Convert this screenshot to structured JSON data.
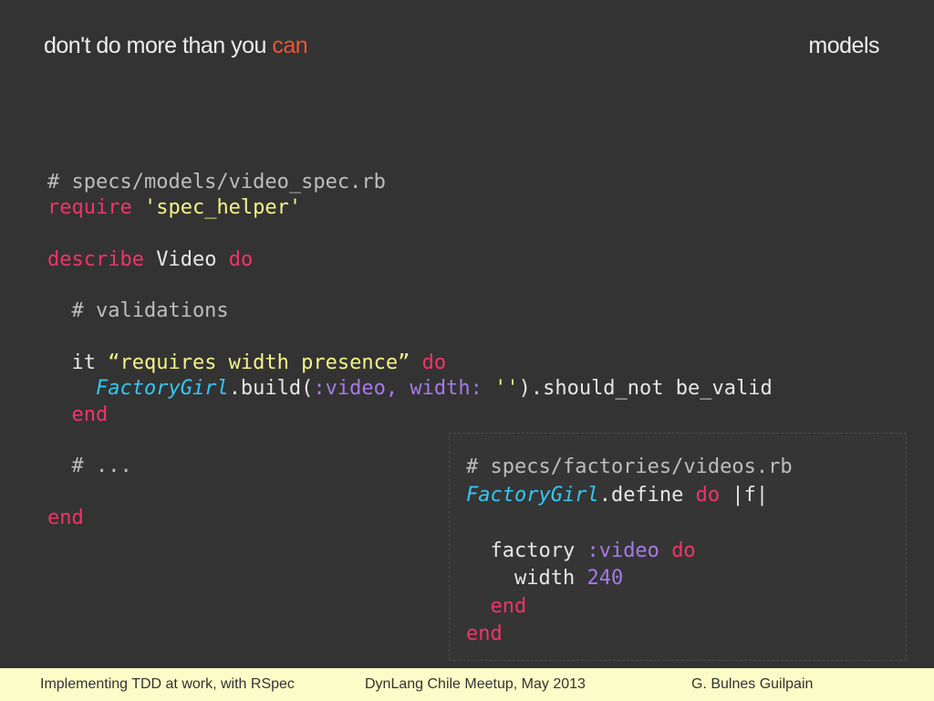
{
  "slide": {
    "title_prefix": "don't do more than you ",
    "title_accent": "can",
    "section": "models"
  },
  "main_code": {
    "line1": "# specs/models/video_spec.rb",
    "line2_kw": "require",
    "line2_str": "'spec_helper'",
    "line4_kw": "describe",
    "line4_class": "Video",
    "line4_do": "do",
    "line6": "  # validations",
    "line8_it": "  it",
    "line8_str": "“requires width presence”",
    "line8_do": "do",
    "line9_const": "FactoryGirl",
    "line9_a": ".build(",
    "line9_sym": ":video, width:",
    "line9_str": "''",
    "line9_b": ").should_not be_valid",
    "line10_end": "end",
    "line12": "  # ...",
    "line14_end": "end"
  },
  "factory_code": {
    "line1": "# specs/factories/videos.rb",
    "line2_const": "FactoryGirl",
    "line2_a": ".define ",
    "line2_do": "do",
    "line2_b": " |f|",
    "line4_a": "  factory ",
    "line4_sym": ":video",
    "line4_do": "do",
    "line5_a": "    width ",
    "line5_num": "240",
    "line6_end": "end",
    "line7_end": "end"
  },
  "footer": {
    "left": "Implementing TDD at work, with RSpec",
    "center": "DynLang Chile Meetup, May 2013",
    "right": "G. Bulnes Guilpain"
  },
  "colors": {
    "background": "#333333",
    "accent": "#e8563a",
    "keyword": "#f2336a",
    "string": "#f4f48a",
    "constant": "#35c6f4",
    "symbol": "#a57ae6",
    "footer_bg": "#fcfcc8"
  }
}
